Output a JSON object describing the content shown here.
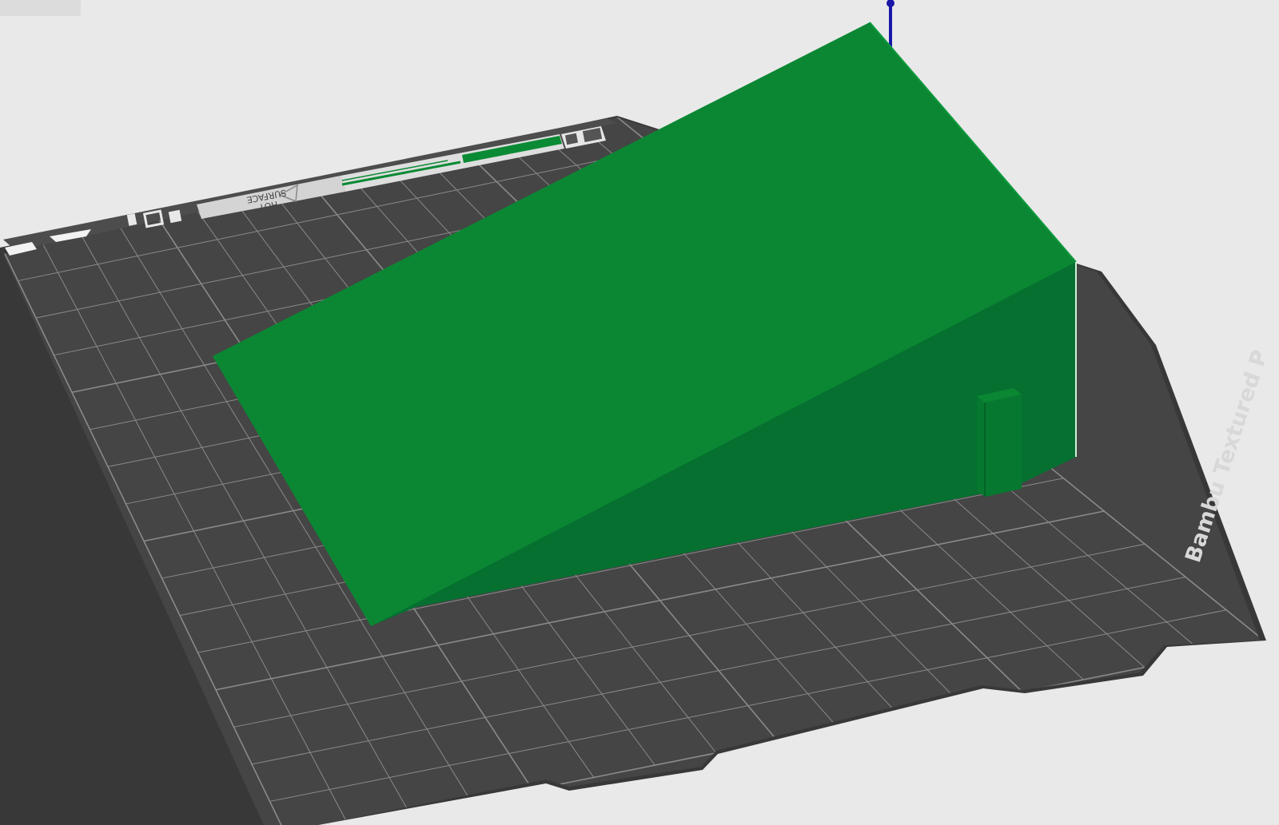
{
  "viewport": {
    "background": "#e9e9e9"
  },
  "build_plate": {
    "name": "Bambu Textured PEI Plate",
    "label": "Bambu Textured P",
    "surface_color": "#454545",
    "edge_color": "#383838",
    "grid_color": "#8a8a8a",
    "warning": {
      "line1": "HOT",
      "line2": "SURFACE"
    }
  },
  "model": {
    "shape": "wedge-ramp",
    "color": "#0a8a34",
    "top_color": "#0b8733",
    "side_color": "#057030"
  },
  "axis": {
    "z_axis_color": "#1a17a8"
  }
}
